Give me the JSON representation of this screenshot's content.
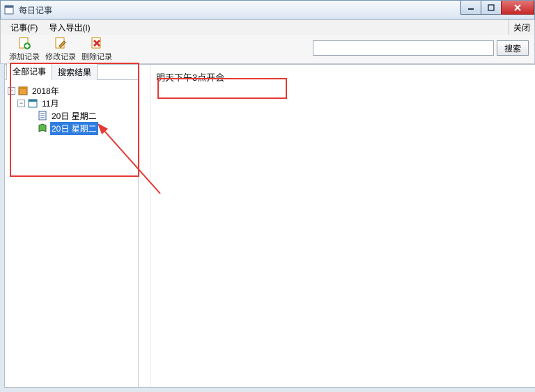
{
  "window": {
    "title": "每日记事"
  },
  "menubar": {
    "items": [
      "记事(F)",
      "导入导出(I)"
    ],
    "right": "关闭"
  },
  "toolbar": {
    "add_label": "添加记录",
    "edit_label": "修改记录",
    "delete_label": "删除记录"
  },
  "search": {
    "placeholder": "",
    "value": "",
    "button_label": "搜索"
  },
  "tabs": {
    "all_label": "全部记事",
    "results_label": "搜索结果",
    "active": 0
  },
  "tree": {
    "year_label": "2018年",
    "month_label": "11月",
    "entries": [
      {
        "label": "20日  星期二",
        "selected": false
      },
      {
        "label": "20日  星期二",
        "selected": true
      }
    ]
  },
  "content": {
    "body": "明天下午3点开会"
  }
}
